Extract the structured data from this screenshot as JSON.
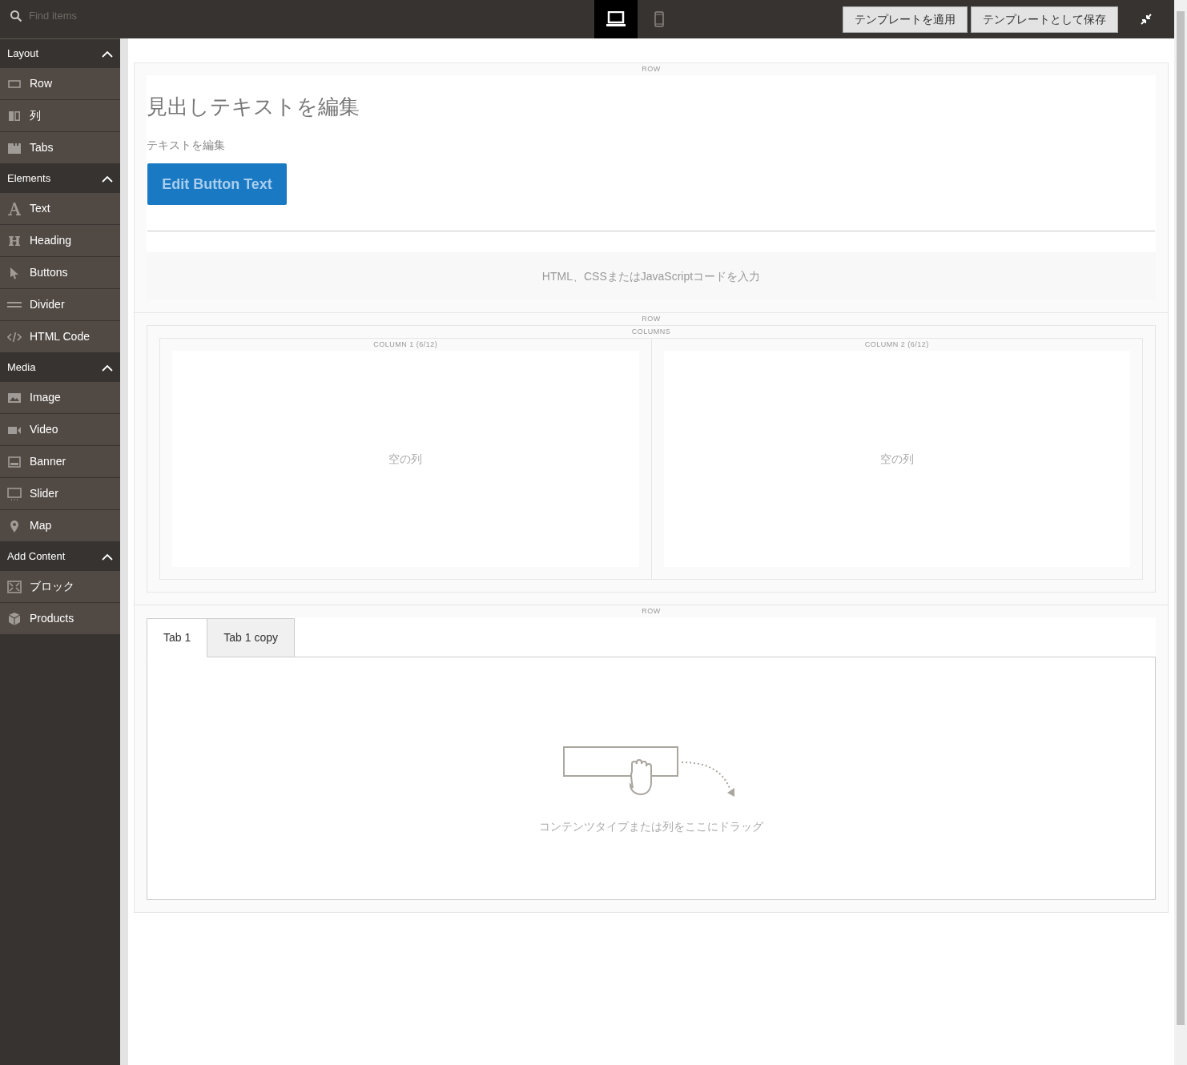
{
  "search": {
    "placeholder": "Find items"
  },
  "devices": [
    {
      "kind": "desktop",
      "selected": true
    },
    {
      "kind": "mobile",
      "selected": false
    }
  ],
  "toolbar_buttons": [
    "テンプレートを適用",
    "テンプレートとして保存"
  ],
  "sidebar": {
    "groups": [
      {
        "title": "Layout",
        "expanded": true,
        "items": [
          {
            "label": "Row",
            "kind": "row"
          },
          {
            "label": "列",
            "kind": "column"
          },
          {
            "label": "Tabs",
            "kind": "tabs"
          }
        ]
      },
      {
        "title": "Elements",
        "expanded": true,
        "items": [
          {
            "label": "Text",
            "kind": "text"
          },
          {
            "label": "Heading",
            "kind": "heading"
          },
          {
            "label": "Buttons",
            "kind": "buttons"
          },
          {
            "label": "Divider",
            "kind": "divider"
          },
          {
            "label": "HTML Code",
            "kind": "code"
          }
        ]
      },
      {
        "title": "Media",
        "expanded": true,
        "items": [
          {
            "label": "Image",
            "kind": "image"
          },
          {
            "label": "Video",
            "kind": "video"
          },
          {
            "label": "Banner",
            "kind": "banner"
          },
          {
            "label": "Slider",
            "kind": "slider"
          },
          {
            "label": "Map",
            "kind": "map"
          }
        ]
      },
      {
        "title": "Add Content",
        "expanded": true,
        "items": [
          {
            "label": "ブロック",
            "kind": "block"
          },
          {
            "label": "Products",
            "kind": "products"
          }
        ]
      }
    ]
  },
  "stage": {
    "rows": [
      {
        "label": "ROW",
        "heading": "見出しテキストを編集",
        "text": "テキストを編集",
        "button": "Edit Button Text",
        "html_placeholder": "HTML、CSSまたはJavaScriptコードを入力"
      },
      {
        "label": "ROW",
        "columns_label": "COLUMNS",
        "columns": [
          {
            "label": "COLUMN 1 (6/12)",
            "placeholder": "空の列"
          },
          {
            "label": "COLUMN 2 (6/12)",
            "placeholder": "空の列"
          }
        ]
      },
      {
        "label": "ROW",
        "tabs": [
          {
            "label": "Tab 1",
            "selected": true
          },
          {
            "label": "Tab 1 copy",
            "selected": false
          }
        ],
        "drop_hint": "コンテンツタイプまたは列をここにドラッグ"
      }
    ]
  }
}
